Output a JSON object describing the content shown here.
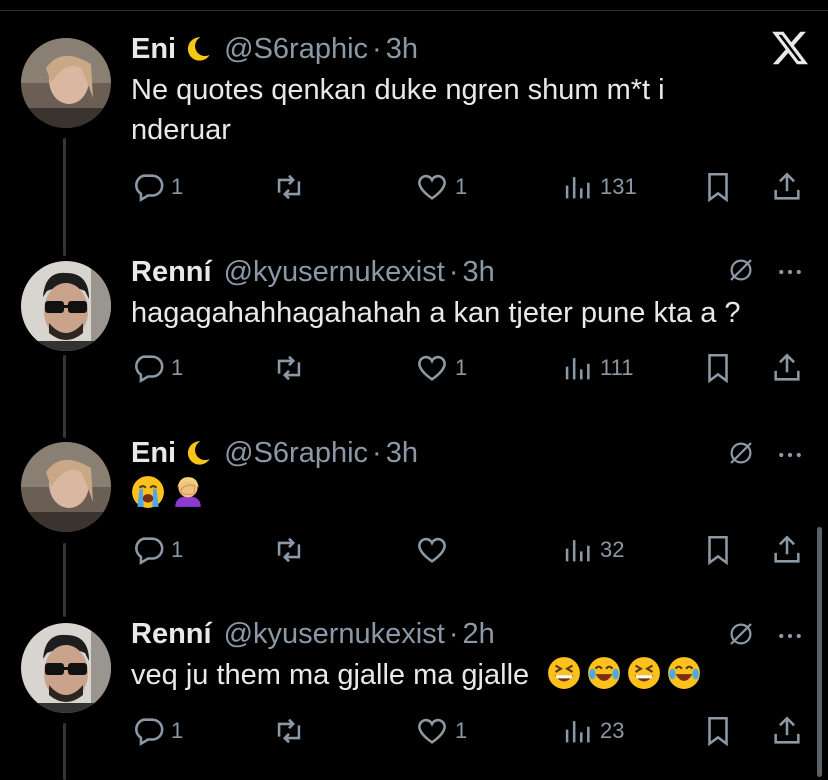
{
  "close_logo": "x-logo",
  "tweets": [
    {
      "name": "Eni",
      "handle": "@S6raphic",
      "dot": "·",
      "time": "3h",
      "text_lines": [
        "Ne quotes qenkan duke ngren shum m*t i",
        "nderuar"
      ],
      "has_moon": true,
      "replies": "1",
      "likes": "1",
      "views": "131"
    },
    {
      "name": "Renní",
      "handle": "@kyusernukexist",
      "dot": "·",
      "time": "3h",
      "text_lines": [
        "hagagahahhagahahah a kan tjeter pune kta a ?"
      ],
      "has_moon": false,
      "replies": "1",
      "likes": "1",
      "views": "111"
    },
    {
      "name": "Eni",
      "handle": "@S6raphic",
      "dot": "·",
      "time": "3h",
      "text_lines": [
        ""
      ],
      "emojis": [
        "loudly-crying-face",
        "woman-facepalming"
      ],
      "has_moon": true,
      "replies": "1",
      "likes": "",
      "views": "32"
    },
    {
      "name": "Renní",
      "handle": "@kyusernukexist",
      "dot": "·",
      "time": "2h",
      "text_lines": [
        "veq ju them ma gjalle ma gjalle"
      ],
      "emojis": [
        "grinning-squinting-face",
        "face-with-tears-of-joy",
        "grinning-squinting-face",
        "face-with-tears-of-joy"
      ],
      "has_moon": false,
      "replies": "1",
      "likes": "1",
      "views": "23"
    }
  ],
  "colors": {
    "background": "#000000",
    "text": "#e7e9ea",
    "secondary": "#8b98a5",
    "thread_line": "#333639"
  }
}
